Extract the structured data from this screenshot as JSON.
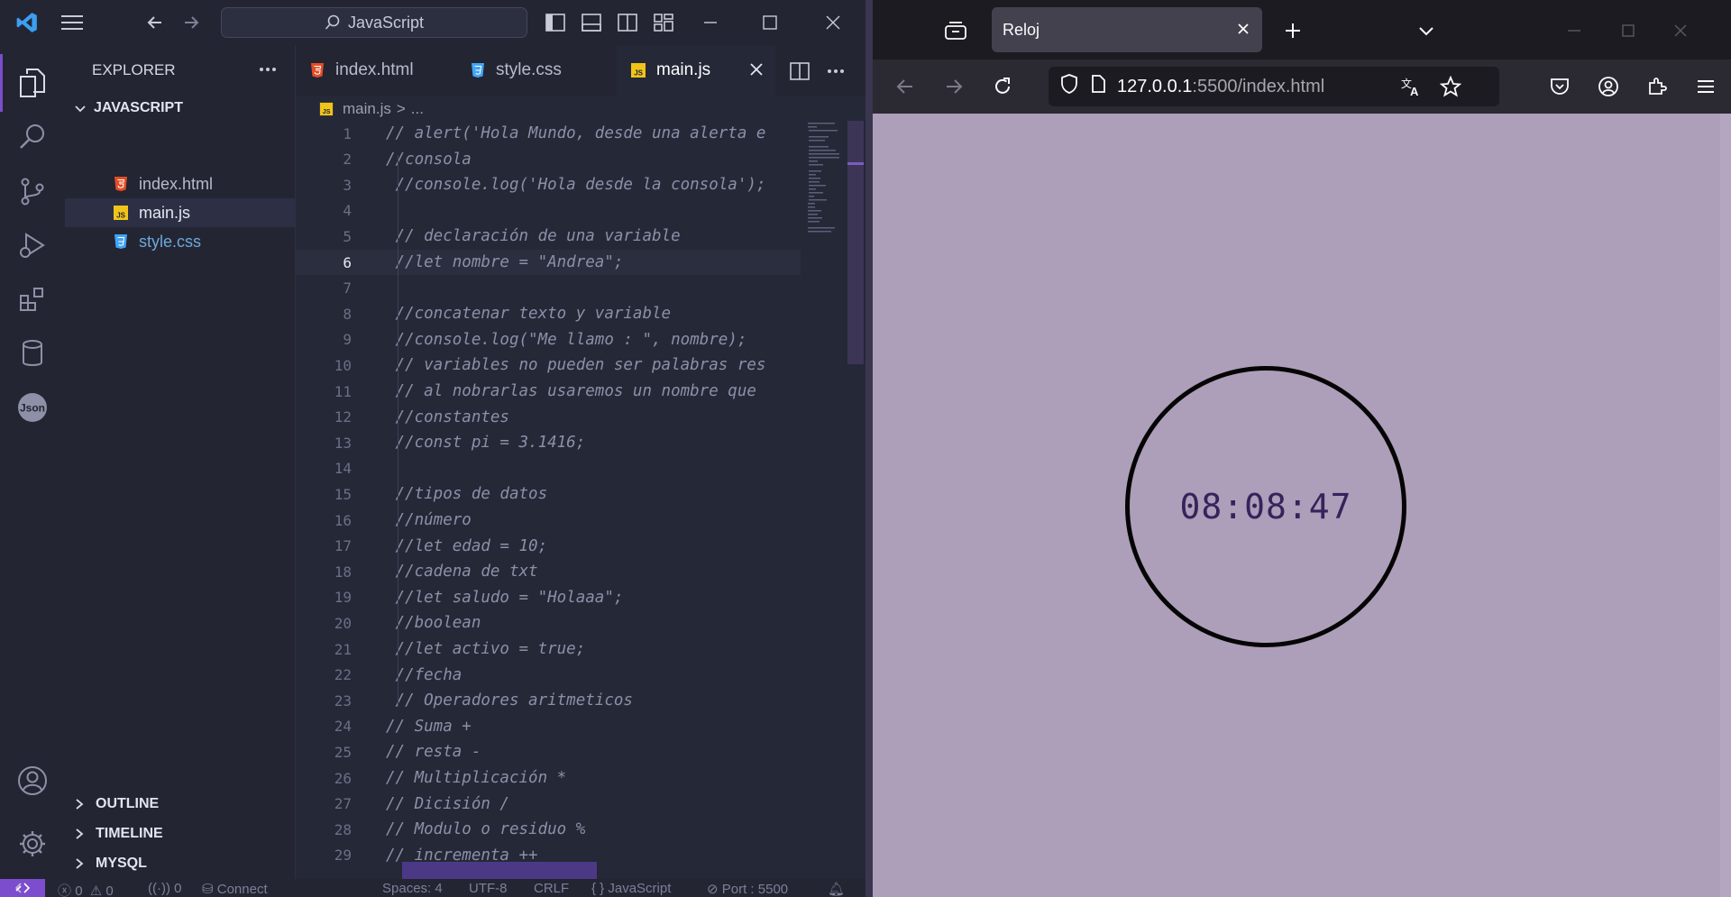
{
  "vscode": {
    "search_text": "JavaScript",
    "explorer_title": "EXPLORER",
    "folder_name": "JAVASCRIPT",
    "files": [
      {
        "name": "index.html",
        "icon": "html5-icon",
        "color": "#e44d26"
      },
      {
        "name": "main.js",
        "icon": "js-icon",
        "color": "#f0c419"
      },
      {
        "name": "style.css",
        "icon": "css3-icon",
        "color": "#42a5f5"
      }
    ],
    "sections": [
      "OUTLINE",
      "TIMELINE",
      "MYSQL"
    ],
    "tabs": [
      {
        "label": "index.html",
        "icon": "html5-icon"
      },
      {
        "label": "style.css",
        "icon": "css3-icon"
      },
      {
        "label": "main.js",
        "icon": "js-icon",
        "active": true
      }
    ],
    "breadcrumb": {
      "file": "main.js",
      "sep": ">",
      "tail": "..."
    },
    "current_line": 6,
    "code_lines": [
      "// alert('Hola Mundo, desde una alerta e",
      "//consola",
      " //console.log('Hola desde la consola');",
      "",
      " // declaración de una variable",
      " //let nombre = \"Andrea\";",
      "",
      " //concatenar texto y variable",
      " //console.log(\"Me llamo : \", nombre);",
      " // variables no pueden ser palabras res",
      " // al nobrarlas usaremos un nombre que",
      " //constantes",
      " //const pi = 3.1416;",
      "",
      " //tipos de datos",
      " //número",
      " //let edad = 10;",
      " //cadena de txt",
      " //let saludo = \"Holaaa\";",
      " //boolean",
      " //let activo = true;",
      " //fecha",
      " // Operadores aritmeticos",
      "// Suma +",
      "// resta -",
      "// Multiplicación *",
      "// Dicisión /",
      "// Modulo o residuo %",
      "// incrementa ++"
    ],
    "status": {
      "errors": "0",
      "warnings": "0",
      "ports": "0",
      "connect": "Connect",
      "spaces": "Spaces: 4",
      "encoding": "UTF-8",
      "eol": "CRLF",
      "language": "JavaScript",
      "port": "Port : 5500"
    },
    "colors": {
      "accent": "#7c4dcc",
      "background": "#252837"
    }
  },
  "browser": {
    "tab_title": "Reloj",
    "url_host": "127.0.0.1",
    "url_rest": ":5500/index.html",
    "clock_time": "08:08:47",
    "colors": {
      "page_bg": "#ad9eb9",
      "clock_text": "#35235c"
    }
  }
}
